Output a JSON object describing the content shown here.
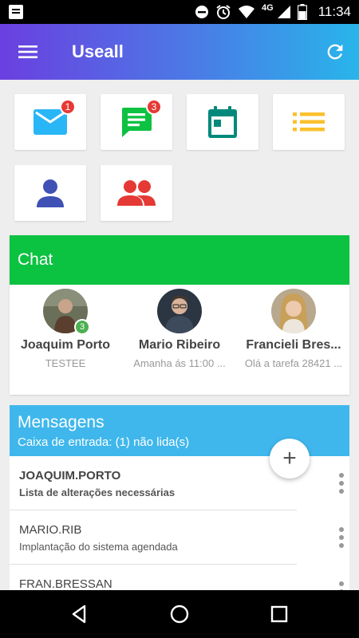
{
  "status_bar": {
    "time": "11:34",
    "network": "4G",
    "icons": [
      "notification-icon",
      "minus-circle-icon",
      "alarm-icon",
      "wifi-icon",
      "signal-icon",
      "battery-icon"
    ]
  },
  "app_bar": {
    "title": "Useall",
    "menu_icon": "menu-icon",
    "refresh_icon": "refresh-icon",
    "color_start": "#6b3fe0",
    "color_end": "#28b5ea"
  },
  "shortcuts": [
    {
      "name": "email",
      "icon": "mail-icon",
      "badge": "1",
      "color": "#29b6f6"
    },
    {
      "name": "messages",
      "icon": "message-icon",
      "badge": "3",
      "color": "#0cc241"
    },
    {
      "name": "calendar",
      "icon": "calendar-icon",
      "badge": "",
      "color": "#00897b"
    },
    {
      "name": "list",
      "icon": "list-icon",
      "badge": "",
      "color": "#fbc02d"
    },
    {
      "name": "user",
      "icon": "person-icon",
      "badge": "",
      "color": "#3f51b5"
    },
    {
      "name": "group",
      "icon": "group-icon",
      "badge": "",
      "color": "#e53935"
    }
  ],
  "chat": {
    "title": "Chat",
    "header_color": "#0cc241",
    "contacts": [
      {
        "name": "Joaquim Porto",
        "subtitle": "TESTEE",
        "badge": "3"
      },
      {
        "name": "Mario Ribeiro",
        "subtitle": "Amanha ás 11:00 ..."
      },
      {
        "name": "Francieli Bres...",
        "subtitle": "Olá a tarefa 28421 ..."
      }
    ]
  },
  "messages": {
    "title": "Mensagens",
    "subtitle": "Caixa de entrada: (1) não lida(s)",
    "header_color": "#3fb7ec",
    "fab_label": "+",
    "items": [
      {
        "from": "JOAQUIM.PORTO",
        "subject": "Lista de alterações necessárias",
        "unread": true
      },
      {
        "from": "MARIO.RIB",
        "subject": "Implantação do sistema agendada",
        "unread": false
      },
      {
        "from": "FRAN.BRESSAN",
        "subject": "",
        "unread": false
      }
    ]
  },
  "nav_bar": {
    "back_icon": "back-icon",
    "home_icon": "home-icon",
    "recents_icon": "recents-icon"
  }
}
